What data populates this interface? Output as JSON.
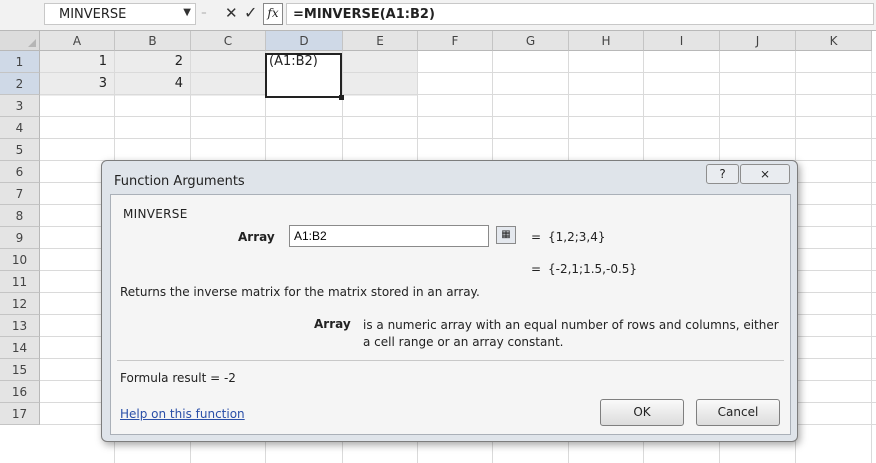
{
  "formula_bar": {
    "name_box": "MINVERSE",
    "name_box_arrow": "▼",
    "separator": "⁼",
    "cancel_icon": "✕",
    "enter_icon": "✓",
    "fx_label": "fx",
    "formula": "=MINVERSE(A1:B2)"
  },
  "sheet": {
    "columns": [
      "A",
      "B",
      "C",
      "D",
      "E",
      "F",
      "G",
      "H",
      "I",
      "J",
      "K"
    ],
    "rows": [
      "1",
      "2",
      "3",
      "4",
      "5",
      "6",
      "7",
      "8",
      "9",
      "10",
      "11",
      "12",
      "13",
      "14",
      "15",
      "16",
      "17"
    ],
    "selected_column": "D",
    "selected_rows": [
      "1",
      "2"
    ],
    "cells": {
      "A1": "1",
      "B1": "2",
      "A2": "3",
      "B2": "4",
      "D1": "(A1:B2)"
    }
  },
  "dialog": {
    "title": "Function Arguments",
    "help_icon": "?",
    "close_icon": "⨯",
    "function_name": "MINVERSE",
    "argument_label": "Array",
    "argument_value": "A1:B2",
    "collapse_icon": "▦",
    "equals": "=",
    "argument_evaluated": "{1,2;3,4}",
    "result_preview": "{-2,1;1.5,-0.5}",
    "description": "Returns the inverse matrix for the matrix stored in an array.",
    "arg_desc_label": "Array",
    "arg_desc": "is a numeric array with an equal number of rows and columns, either a cell range or an array constant.",
    "formula_result": "Formula result =  -2",
    "help_link": "Help on this function",
    "ok_label": "OK",
    "cancel_label": "Cancel"
  },
  "colors": {
    "selection_header": "#cfd9e7",
    "dialog_bg": "#dfe4ea",
    "link": "#2a4fa8"
  }
}
